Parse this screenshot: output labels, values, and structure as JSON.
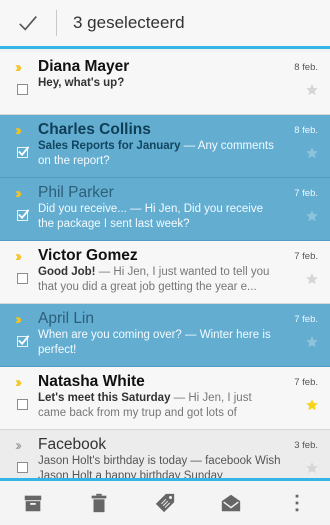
{
  "action_bar": {
    "selection_count": "3 geselecteerd"
  },
  "messages": [
    {
      "sender": "Diana Mayer",
      "subject": "Hey, what's up?",
      "preview": "",
      "date": "8 feb.",
      "selected": false,
      "read": false,
      "starred": false
    },
    {
      "sender": "Charles Collins",
      "subject": "Sales Reports for January",
      "preview": " — Any comments on the report?",
      "date": "8 feb.",
      "selected": true,
      "read": false,
      "starred": false
    },
    {
      "sender": "Phil Parker",
      "subject": "Did you receive...",
      "preview": " — Hi Jen, Did you receive the package I sent last week?",
      "date": "7 feb.",
      "selected": true,
      "read": true,
      "starred": false
    },
    {
      "sender": "Victor Gomez",
      "subject": "Good Job!",
      "preview": " — Hi Jen, I just wanted to tell you that you did a great job getting the year e...",
      "date": "7 feb.",
      "selected": false,
      "read": false,
      "starred": false
    },
    {
      "sender": "April Lin",
      "subject": "When are you coming over?",
      "preview": " — Winter here is perfect!",
      "date": "7 feb.",
      "selected": true,
      "read": true,
      "starred": false
    },
    {
      "sender": "Natasha White",
      "subject": "Let's meet this Saturday",
      "preview": " — Hi Jen, I just came back from my trup and got lots of",
      "date": "7 feb.",
      "selected": false,
      "read": false,
      "starred": true
    },
    {
      "sender": "Facebook",
      "subject": "",
      "preview": "Jason Holt's birthday is today — facebook Wish Jason Holt a happy birthday Sunday",
      "date": "3 feb.",
      "selected": false,
      "read": true,
      "starred": false
    }
  ],
  "colors": {
    "accent": "#35b5e5",
    "selected_row": "#63add1",
    "importance_marker": "#f5c41a",
    "star_on": "#f7d417"
  },
  "toolbar": {
    "icons": [
      "archive-icon",
      "delete-icon",
      "label-icon",
      "mark-read-icon",
      "overflow-menu-icon"
    ]
  }
}
